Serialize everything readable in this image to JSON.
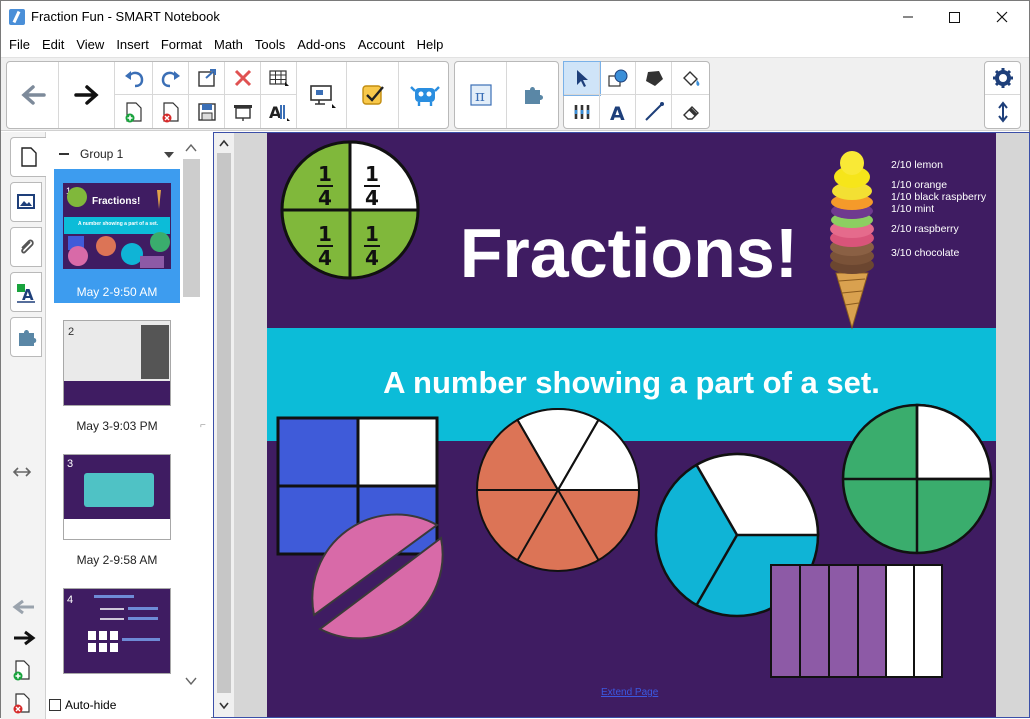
{
  "window": {
    "title": "Fraction Fun - SMART Notebook",
    "minimize_glyph": "—",
    "maximize_glyph": "☐",
    "close_glyph": "✕"
  },
  "menu": [
    "File",
    "Edit",
    "View",
    "Insert",
    "Format",
    "Math",
    "Tools",
    "Add-ons",
    "Account",
    "Help"
  ],
  "toolbar": {
    "icons": [
      "back-icon",
      "forward-icon",
      "undo-icon",
      "redo-icon",
      "add-page-icon",
      "delete-page-icon",
      "paste-icon",
      "save-icon",
      "delete-icon",
      "presentation-icon",
      "table-icon",
      "text-properties-icon",
      "screen-display-icon",
      "response-check-icon",
      "add-on-monster-icon",
      "math-pi-icon",
      "puzzle-icon",
      "select-icon",
      "shapes-icon",
      "pens-icon",
      "text-icon",
      "polygon-icon",
      "line-icon",
      "fill-icon",
      "eraser-icon",
      "settings-icon",
      "move-toolbar-icon"
    ]
  },
  "sorter": {
    "group": "Group 1",
    "pages": [
      {
        "number": "1",
        "date": "May 2-9:50 AM",
        "selected": true
      },
      {
        "number": "2",
        "date": "May 3-9:03 PM",
        "selected": false
      },
      {
        "number": "3",
        "date": "May 2-9:58 AM",
        "selected": false
      },
      {
        "number": "4",
        "date": "",
        "selected": false
      }
    ],
    "autohide_label": "Auto-hide"
  },
  "slide": {
    "title": "Fractions!",
    "subtitle": "A number showing a part of a set.",
    "quarter_label": "1\n4",
    "legend": [
      "2/10 lemon",
      "1/10 orange",
      "1/10 black raspberry",
      "1/10 mint",
      "2/10 raspberry",
      "3/10 chocolate"
    ],
    "extend_link": "Extend Page",
    "thumb1_title": "Fractions!",
    "thumb1_sub": "A number showing a part of a set."
  },
  "colors": {
    "slide_bg": "#3f1c62",
    "banner": "#0cbcd8",
    "green": "#80b83b",
    "blue_square": "#3f5bd9",
    "pink": "#d86aa8",
    "orange": "#dc7456",
    "cyan": "#0fb4d6",
    "teal_green": "#3aad6d",
    "violet": "#8d5aa6"
  }
}
